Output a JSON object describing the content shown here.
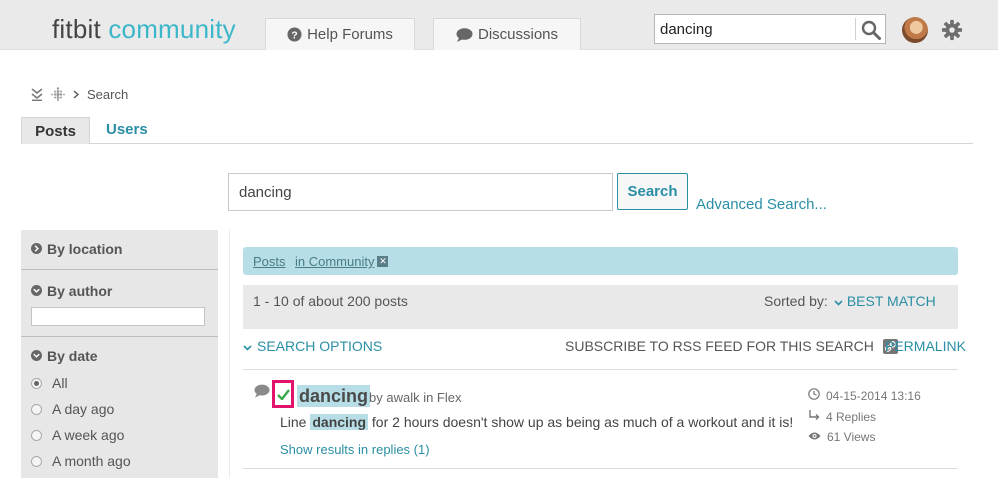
{
  "header": {
    "logo_part1": "fitbit",
    "logo_part2": "community",
    "tabs": [
      {
        "label": "Help Forums",
        "icon": "question-circle-icon"
      },
      {
        "label": "Discussions",
        "icon": "speech-bubble-icon"
      }
    ],
    "search_value": "dancing"
  },
  "breadcrumb": {
    "items": [
      "Search"
    ]
  },
  "subtabs": {
    "posts": "Posts",
    "users": "Users"
  },
  "search": {
    "value": "dancing",
    "button": "Search",
    "advanced": "Advanced Search..."
  },
  "sidebar": {
    "by_location": "By location",
    "by_author": "By author",
    "by_date": "By date",
    "date_options": [
      "All",
      "A day ago",
      "A week ago",
      "A month ago"
    ],
    "selected_date": "All"
  },
  "results": {
    "filter_posts": "Posts",
    "filter_scope": "in Community",
    "count_text": "1 - 10 of about 200 posts",
    "sorted_by_label": "Sorted by:",
    "sorted_by_value": "BEST MATCH",
    "search_options": "SEARCH OPTIONS",
    "rss": "SUBSCRIBE TO RSS FEED FOR THIS SEARCH",
    "permalink": "PERMALINK",
    "items": [
      {
        "title": "dancing",
        "by": "by awalk in Flex",
        "body_before": "Line",
        "body_highlight": "dancing",
        "body_after": "for 2 hours doesn't show up as being as much of a workout and it is!",
        "replies_link": "Show results in replies (1)",
        "date": "04-15-2014 13:16",
        "replies": "4 Replies",
        "views": "61 Views"
      }
    ]
  },
  "colors": {
    "accent": "#2a8fa5",
    "logo_teal": "#3cb7c9",
    "highlight": "#b7dee6",
    "solved_box": "#e3126a"
  }
}
